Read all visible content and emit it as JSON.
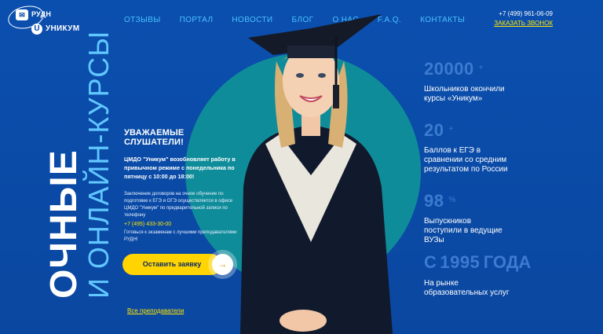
{
  "header": {
    "logo_rudn": "РУДН",
    "logo_unikum": "УНИКУМ",
    "nav": [
      "ОТЗЫВЫ",
      "ПОРТАЛ",
      "НОВОСТИ",
      "БЛОГ",
      "О НАС",
      "F.A.Q.",
      "КОНТАКТЫ"
    ],
    "phone": "+7 (499) 961-06-09",
    "callback": "ЗАКАЗАТЬ ЗВОНОК"
  },
  "hero": {
    "line1": "ОЧНЫЕ",
    "line2": "И ОНЛАЙН-КУРСЫ"
  },
  "notice": {
    "title": "УВАЖАЕМЫЕ СЛУШАТЕЛИ!",
    "lead": "ЦМДО \"Уникум\" возобновляет работу в привычном режиме с понедельника по пятницу с 10:00 до 18:00!",
    "body": "Заключение договоров на очное обучение по подготовке к ЕГЭ и ОГЭ осуществляется в офисе ЦМДО \"Уникум\" по предварительной записи по телефону",
    "tel": "+7 (495) 433-30-00",
    "after": "Готовься к экзаменам с лучшими преподавателями РУДН!"
  },
  "cta": {
    "label": "Оставить заявку",
    "arrow": "→"
  },
  "teachers_link": "Все преподаватели",
  "stats": [
    {
      "num": "20000",
      "suffix": "+",
      "text": "Школьников окончили курсы «Уникум»"
    },
    {
      "num": "20",
      "suffix": "+",
      "text": "Баллов к ЕГЭ в сравнении со средним результатом по России"
    },
    {
      "num": "98",
      "suffix": "%",
      "text": "Выпускников поступили в ведущие ВУЗы"
    },
    {
      "prefix": "С",
      "num": "1995",
      "suffix2": "ГОДА",
      "text": "На рынке образовательных услуг"
    }
  ],
  "colors": {
    "bg": "#0a4aa5",
    "circle": "#0f8c9a",
    "accent": "#ffd400",
    "nav": "#49c0ff"
  }
}
